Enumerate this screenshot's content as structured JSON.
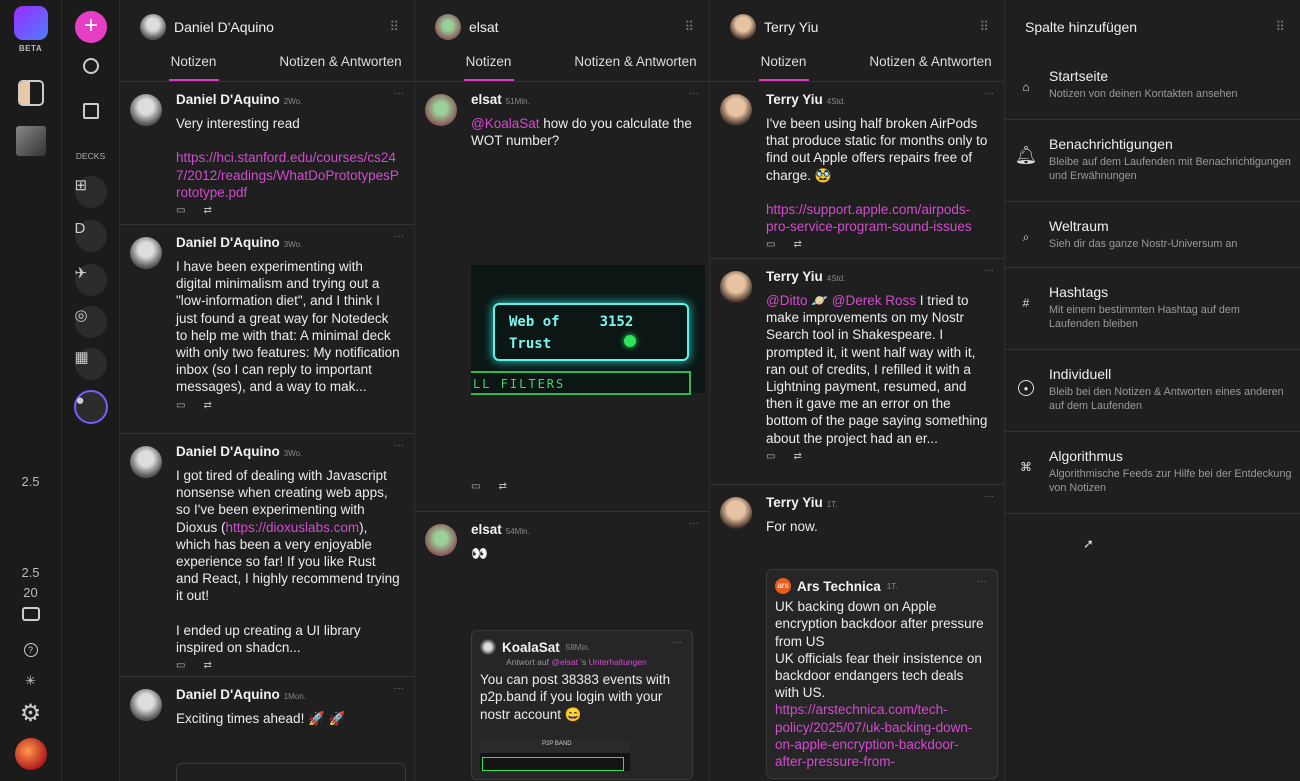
{
  "sidebar": {
    "beta_label": "BETA",
    "decks_label": "DECKS",
    "deck_letter": "D",
    "zoom_top": "2.5",
    "zoom_bottom": "20"
  },
  "columns": [
    {
      "title": "Daniel D'Aquino",
      "tabs": [
        "Notizen",
        "Notizen & Antworten"
      ],
      "notes": [
        {
          "name": "Daniel D'Aquino",
          "time": "2Wo.",
          "body": "Very interesting read\n\n",
          "link": "https://hci.stanford.edu/courses/cs247/2012/readings/WhatDoPrototypesPrototype.pdf"
        },
        {
          "name": "Daniel D'Aquino",
          "time": "3Wo.",
          "body": "I have been experimenting with digital minimalism and trying out a \"low-information diet\", and I think I just found a great way for Notedeck to help me with that: A minimal deck with only two features: My notification inbox (so I can reply to important messages), and a way to mak..."
        },
        {
          "name": "Daniel D'Aquino",
          "time": "3Wo.",
          "body_a": "I got tired of dealing with Javascript nonsense when creating web apps, so I've been experimenting with Dioxus (",
          "link": "https://dioxuslabs.com",
          "body_b": "), which has been a very enjoyable experience so far! If you like Rust and React, I highly recommend trying it out!\n\nI ended up creating a UI library inspired on shadcn..."
        },
        {
          "name": "Daniel D'Aquino",
          "time": "1Mon.",
          "body": "Exciting times ahead! 🚀 🚀"
        }
      ]
    },
    {
      "title": "elsat",
      "tabs": [
        "Notizen",
        "Notizen & Antworten"
      ],
      "notes": [
        {
          "name": "elsat",
          "time": "51Min.",
          "mention": "@KoalaSat",
          "body": " how do you calculate the WOT number?",
          "image": {
            "line1": "Web of",
            "value": "3152",
            "line2": "Trust",
            "footer": "LL FILTERS"
          }
        },
        {
          "name": "elsat",
          "time": "54Min.",
          "body": "👀",
          "embed": {
            "name": "KoalaSat",
            "time": "58Min.",
            "reply_prefix": "Antwort auf",
            "reply_user": "@elsat",
            "reply_mid": "'s",
            "reply_thread": "Unterhaltungen",
            "body": "You can post 38383 events with p2p.band if you login with your nostr account 😄",
            "shot_title": "P2P BAND"
          }
        }
      ]
    },
    {
      "title": "Terry Yiu",
      "tabs": [
        "Notizen",
        "Notizen & Antworten"
      ],
      "notes": [
        {
          "name": "Terry Yiu",
          "time": "4Std.",
          "body": "I've been using half broken AirPods that produce static for months only to find out Apple offers repairs free of charge. 🥸\n\n",
          "link": "https://support.apple.com/airpods-pro-service-program-sound-issues"
        },
        {
          "name": "Terry Yiu",
          "time": "4Std.",
          "mention1": "@Ditto 🪐",
          "mention2": "@Derek Ross",
          "body": " I tried to make improvements on my Nostr Search tool in Shakespeare. I prompted it, it went half way with it, ran out of credits, I refilled it with a Lightning payment, resumed, and then it gave me an error on the bottom of the page saying something about the project had an er..."
        },
        {
          "name": "Terry Yiu",
          "time": "1T.",
          "body": "For now.",
          "embed": {
            "name": "Ars Technica",
            "avatar_text": "ars",
            "time": "1T.",
            "body": "UK backing down on Apple encryption backdoor after pressure from US\nUK officials fear their insistence on backdoor endangers tech deals with US.\n",
            "link": "https://arstechnica.com/tech-policy/2025/07/uk-backing-down-on-apple-encryption-backdoor-after-pressure-from-"
          }
        }
      ]
    }
  ],
  "add_column": {
    "title": "Spalte hinzufügen",
    "items": [
      {
        "title": "Startseite",
        "desc": "Notizen von deinen Kontakten ansehen",
        "icon": "home-icon"
      },
      {
        "title": "Benachrichtigungen",
        "desc": "Bleibe auf dem Laufenden mit Benachrichtigungen und Erwähnungen",
        "icon": "bell-icon"
      },
      {
        "title": "Weltraum",
        "desc": "Sieh dir das ganze Nostr-Universum an",
        "icon": "search-icon"
      },
      {
        "title": "Hashtags",
        "desc": "Mit einem bestimmten Hashtag auf dem Laufenden bleiben",
        "icon": "hashtag-icon"
      },
      {
        "title": "Individuell",
        "desc": "Bleib bei den Notizen & Antworten eines anderen auf dem Laufenden",
        "icon": "user-icon"
      },
      {
        "title": "Algorithmus",
        "desc": "Algorithmische Feeds zur Hilfe bei der Entdeckung von Notizen",
        "icon": "algorithm-icon"
      }
    ]
  },
  "colors": {
    "accent": "#d34bcf",
    "compose": "#e63ec4",
    "background": "#1f1f1f"
  }
}
